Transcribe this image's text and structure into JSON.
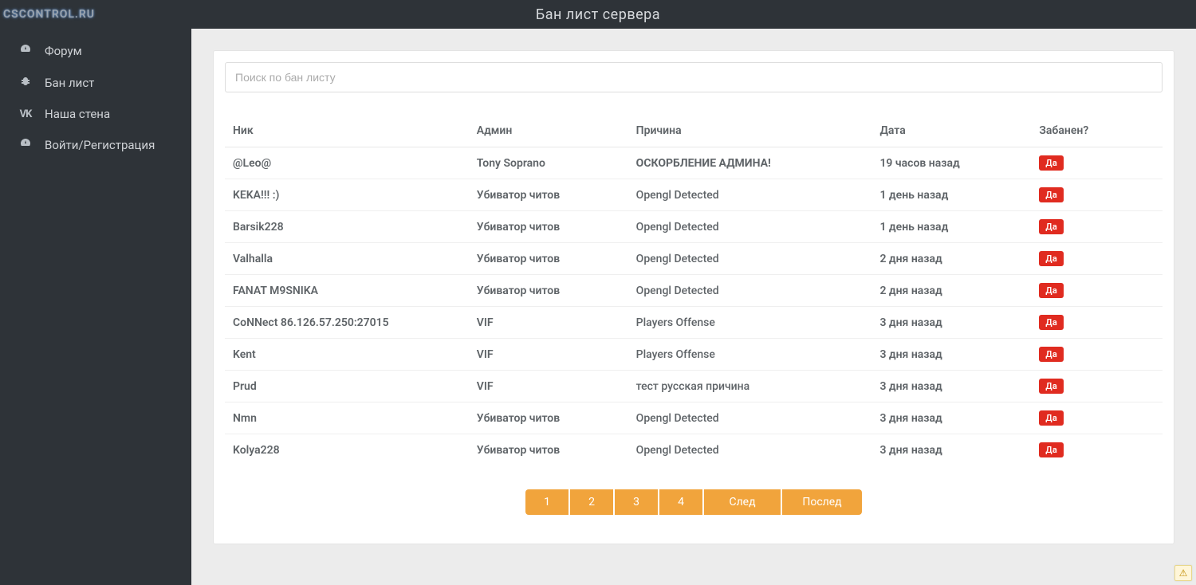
{
  "watermark": "CSCONTROL.RU",
  "header": {
    "title": "Бан лист сервера"
  },
  "sidebar": {
    "items": [
      {
        "label": "Форум",
        "icon": "dashboard-icon"
      },
      {
        "label": "Бан лист",
        "icon": "bug-icon"
      },
      {
        "label": "Наша стена",
        "icon": "vk-icon"
      },
      {
        "label": "Войти/Регистрация",
        "icon": "dashboard-icon"
      }
    ]
  },
  "search": {
    "placeholder": "Поиск по бан листу",
    "value": ""
  },
  "table": {
    "headers": {
      "nick": "Ник",
      "admin": "Админ",
      "reason": "Причина",
      "date": "Дата",
      "banned": "Забанен?"
    },
    "rows": [
      {
        "nick": "@Leo@",
        "admin": "Tony Soprano",
        "reason": "ОСКОРБЛЕНИЕ АДМИНА!",
        "reason_bold": true,
        "date": "19 часов назад",
        "banned": "Да"
      },
      {
        "nick": "KEKA!!! :)",
        "admin": "Убиватор читов",
        "reason": "Opengl Detected",
        "date": "1 день назад",
        "banned": "Да"
      },
      {
        "nick": "Barsik228",
        "admin": "Убиватор читов",
        "reason": "Opengl Detected",
        "date": "1 день назад",
        "banned": "Да"
      },
      {
        "nick": "Valhalla",
        "admin": "Убиватор читов",
        "reason": "Opengl Detected",
        "date": "2 дня назад",
        "banned": "Да"
      },
      {
        "nick": "FANAT M9SNIKA",
        "admin": "Убиватор читов",
        "reason": "Opengl Detected",
        "date": "2 дня назад",
        "banned": "Да"
      },
      {
        "nick": "CoNNect 86.126.57.250:27015",
        "admin": "VIF",
        "reason": "Players Offense",
        "date": "3 дня назад",
        "banned": "Да"
      },
      {
        "nick": "Kent",
        "admin": "VIF",
        "reason": "Players Offense",
        "date": "3 дня назад",
        "banned": "Да"
      },
      {
        "nick": "Prud",
        "admin": "VIF",
        "reason": "тест русская причина",
        "date": "3 дня назад",
        "banned": "Да"
      },
      {
        "nick": "Nmn",
        "admin": "Убиватор читов",
        "reason": "Opengl Detected",
        "date": "3 дня назад",
        "banned": "Да"
      },
      {
        "nick": "Kolya228",
        "admin": "Убиватор читов",
        "reason": "Opengl Detected",
        "date": "3 дня назад",
        "banned": "Да"
      }
    ]
  },
  "pagination": {
    "pages": [
      "1",
      "2",
      "3",
      "4"
    ],
    "next": "След",
    "last": "Послед"
  },
  "corner_warning_glyph": "⚠"
}
